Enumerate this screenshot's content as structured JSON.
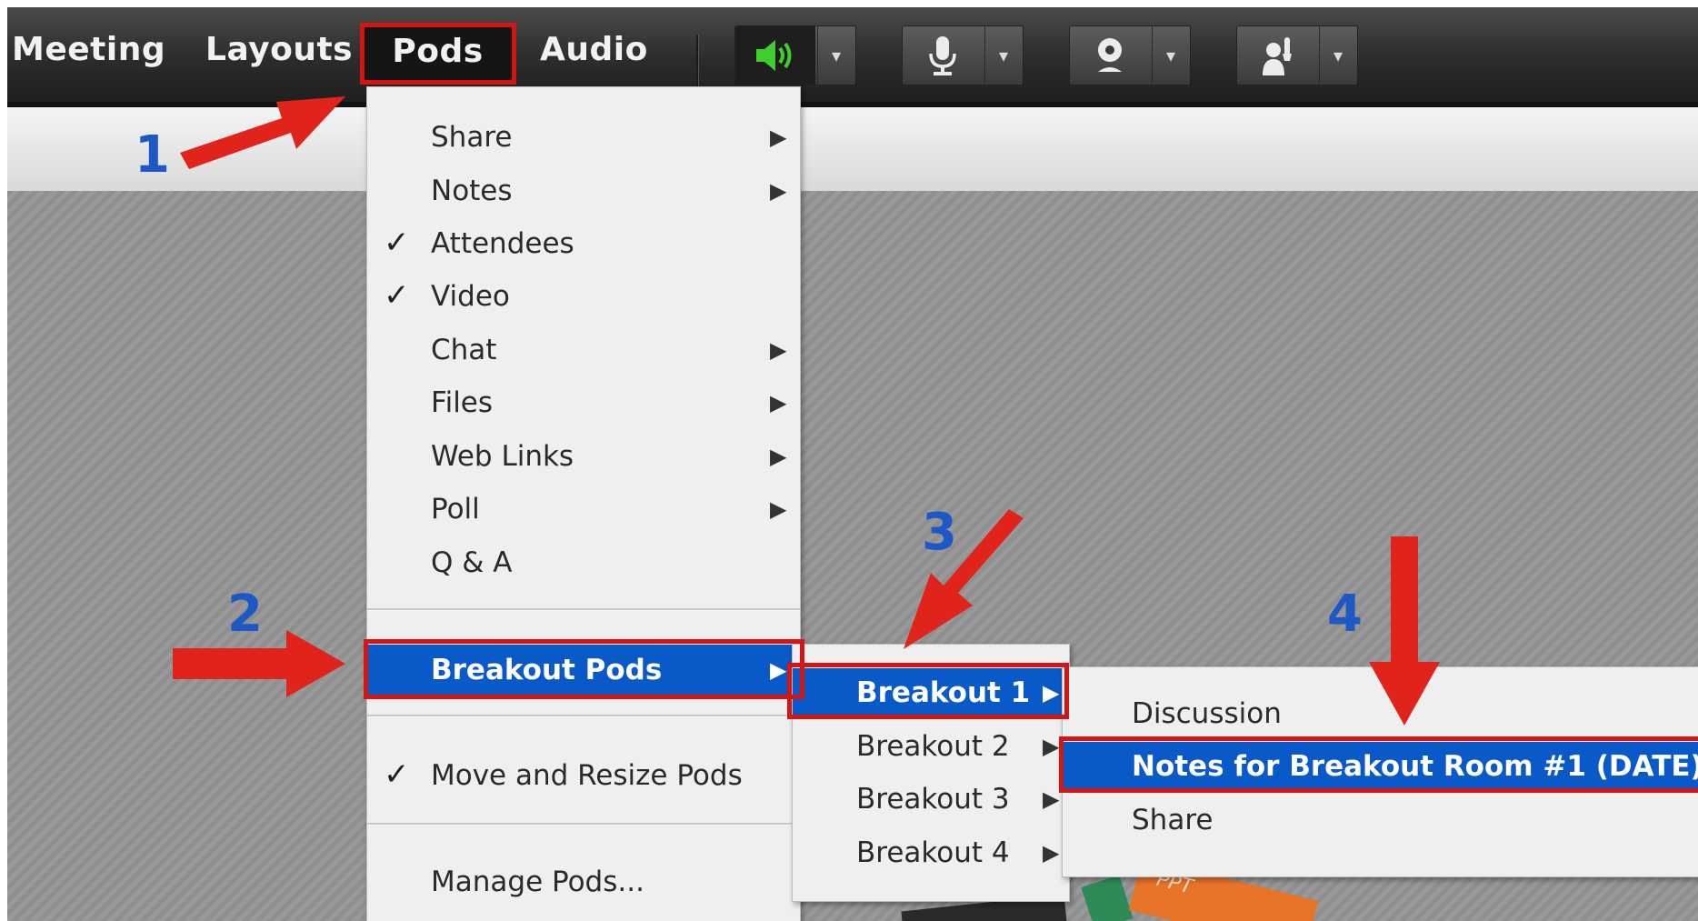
{
  "menubar": {
    "items": [
      "Meeting",
      "Layouts",
      "Pods",
      "Audio"
    ]
  },
  "toolbar": {
    "speaker_icon": "speaker-icon",
    "mic_icon": "microphone-icon",
    "camera_icon": "webcam-icon",
    "status_icon": "raise-hand-icon",
    "dropdown_glyph": "▾"
  },
  "pods_menu": {
    "items": [
      "Share",
      "Notes",
      "Attendees",
      "Video",
      "Chat",
      "Files",
      "Web Links",
      "Poll",
      "Q & A"
    ],
    "breakout": "Breakout Pods",
    "move_resize": "Move and Resize Pods",
    "manage": "Manage Pods..."
  },
  "breakout_menu": {
    "items": [
      "Breakout 1",
      "Breakout 2",
      "Breakout 3",
      "Breakout 4"
    ]
  },
  "notes_submenu": {
    "items": [
      "Discussion",
      "Notes for Breakout Room #1 (DATE)",
      "Share"
    ]
  },
  "annotations": {
    "step1": "1",
    "step2": "2",
    "step3": "3",
    "step4": "4"
  },
  "colors": {
    "highlight": "#0a59c8",
    "arrow": "#e0241b",
    "step_number": "#1d58c4",
    "speaker_active": "#3ecf2f"
  },
  "glyphs": {
    "check": "✓",
    "submenu": "▶"
  },
  "pod_thumbnail_label": "PPT"
}
